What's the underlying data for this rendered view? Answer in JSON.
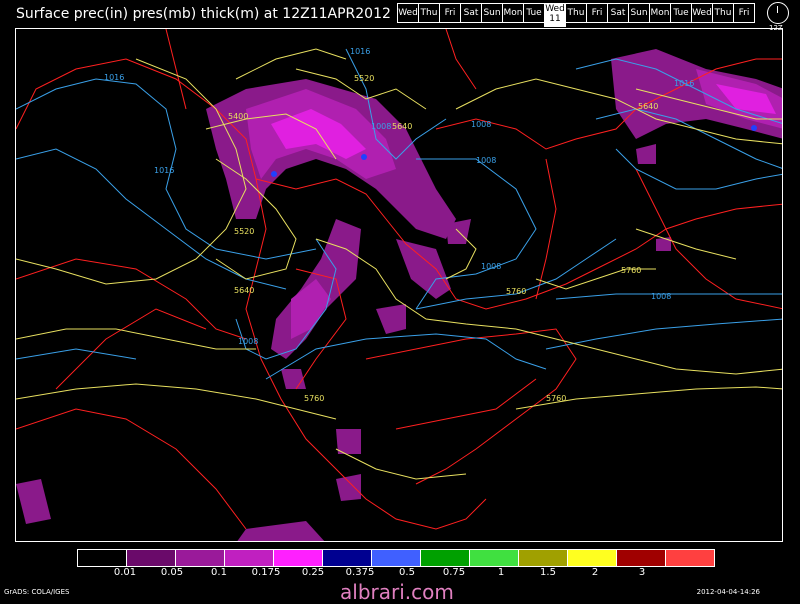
{
  "header": {
    "title": "Surface prec(in) pres(mb) thick(m) at 12Z11APR2012",
    "days": [
      "Wed",
      "Thu",
      "Fri",
      "Sat",
      "Sun",
      "Mon",
      "Tue",
      "Wed",
      "Thu",
      "Fri",
      "Sat",
      "Sun",
      "Mon",
      "Tue",
      "Wed",
      "Thu",
      "Fri"
    ],
    "selected_day": "Wed",
    "selected_date": "11",
    "clock_label": "12Z"
  },
  "map": {
    "pressure_labels": [
      "1016",
      "1016",
      "1016",
      "1016",
      "1008",
      "1008",
      "1008",
      "1008",
      "1008",
      "1008"
    ],
    "thickness_labels": [
      "5520",
      "5400",
      "5640",
      "5520",
      "5640",
      "5640",
      "5760",
      "5760",
      "5760",
      "5760"
    ],
    "colors": {
      "pressure_contour": "#3aa0e8",
      "thickness_contour": "#e8e060",
      "coastline": "#ff2020",
      "precip_light": "#8a1a8a",
      "precip_mid": "#b020b0",
      "precip_heavy": "#e020e0"
    }
  },
  "legend": {
    "colors": [
      "#000000",
      "#6a0a6a",
      "#9a1a9a",
      "#c020c0",
      "#ff20ff",
      "#000090",
      "#4060ff",
      "#00a000",
      "#40e040",
      "#a0a000",
      "#ffff20",
      "#a00000",
      "#ff4040"
    ],
    "ticks": [
      "0.01",
      "0.05",
      "0.1",
      "0.175",
      "0.25",
      "0.375",
      "0.5",
      "0.75",
      "1",
      "1.5",
      "2",
      "3"
    ]
  },
  "footer": {
    "left": "GrADS: COLA/IGES",
    "right": "2012-04-04-14:26",
    "watermark": "albrari.com"
  }
}
